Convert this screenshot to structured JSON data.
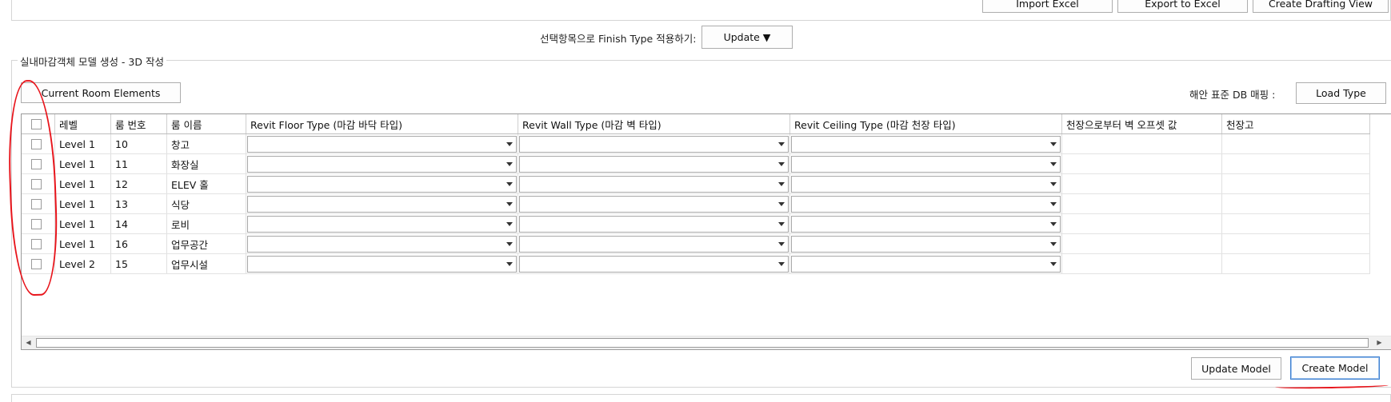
{
  "top_buttons": {
    "import_excel": "Import Excel",
    "export_excel": "Export to Excel",
    "create_drafting": "Create Drafting View"
  },
  "finish_type": {
    "label": "선택항목으로 Finish Type 적용하기:",
    "update_label": "Update ▼"
  },
  "group": {
    "title": "실내마감객체 모델 생성 - 3D 작성",
    "current_room_label": "Current Room Elements",
    "db_mapping_label": "해안 표준 DB 매핑 :",
    "load_type_label": "Load Type"
  },
  "table": {
    "headers": {
      "level": "레벨",
      "room_number": "룸 번호",
      "room_name": "룸 이름",
      "floor_type": "Revit Floor Type (마감 바닥 타입)",
      "wall_type": "Revit Wall Type (마감 벽 타입)",
      "ceiling_type": "Revit Ceiling Type (마감 천장 타입)",
      "wall_offset": "천장으로부터 벽 오프셋 값",
      "ceiling_height": "천장고"
    },
    "rows": [
      {
        "level": "Level 1",
        "number": "10",
        "name": "창고"
      },
      {
        "level": "Level 1",
        "number": "11",
        "name": "화장실"
      },
      {
        "level": "Level 1",
        "number": "12",
        "name": "ELEV 홀"
      },
      {
        "level": "Level 1",
        "number": "13",
        "name": "식당"
      },
      {
        "level": "Level 1",
        "number": "14",
        "name": "로비"
      },
      {
        "level": "Level 1",
        "number": "16",
        "name": "업무공간"
      },
      {
        "level": "Level 2",
        "number": "15",
        "name": "업무시설"
      }
    ]
  },
  "bottom_buttons": {
    "update_model": "Update Model",
    "create_model": "Create Model"
  },
  "colors": {
    "annotation": "#e8141b",
    "focus_border": "#3c7fd0"
  }
}
